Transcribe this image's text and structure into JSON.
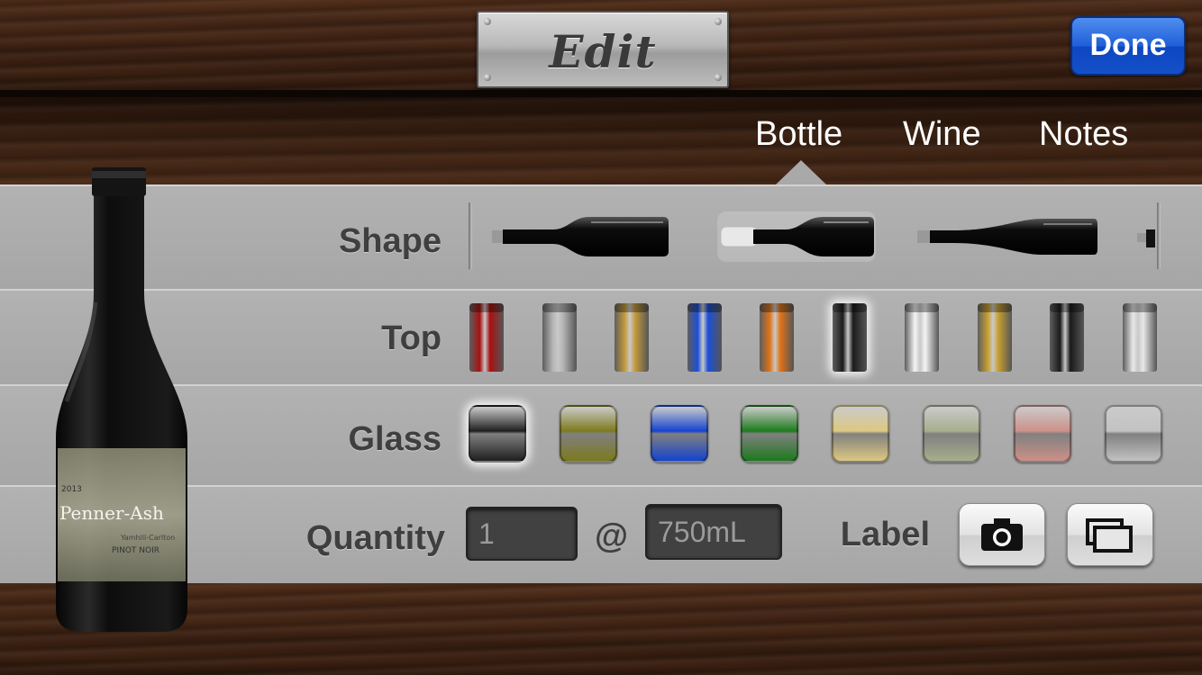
{
  "header": {
    "title": "Edit",
    "done_label": "Done"
  },
  "tabs": [
    {
      "label": "Bottle",
      "selected": true
    },
    {
      "label": "Wine",
      "selected": false
    },
    {
      "label": "Notes",
      "selected": false
    }
  ],
  "rows": {
    "shape": {
      "label": "Shape",
      "options": [
        "bottle-shape-burgundy",
        "bottle-shape-champagne",
        "bottle-shape-riesling"
      ],
      "selected_index": 1
    },
    "top": {
      "label": "Top",
      "options": [
        "#a81010",
        "#b5b5b5",
        "#c49a3a",
        "#1c4fd8",
        "#e07418",
        "#1b1b1b",
        "#f4f4f4",
        "#c8a030",
        "#1a1a1a",
        "#e8e8e8"
      ],
      "selected_index": 5
    },
    "glass": {
      "label": "Glass",
      "options": [
        "#1f1f1f",
        "#7c7a1c",
        "#1443d0",
        "#1c7a1c",
        "#ddc880",
        "#a6ae8c",
        "#cc9088",
        "#c2c2c2"
      ],
      "selected_index": 0
    },
    "quantity": {
      "label": "Quantity",
      "value": "1",
      "at_symbol": "@",
      "size": "750mL",
      "label_text": "Label",
      "camera_icon": "camera-icon",
      "gallery_icon": "photo-library-icon"
    }
  },
  "preview_bottle": {
    "label_vintage": "2013",
    "label_brand": "Penner-Ash",
    "label_region": "Yamhill-Carlton",
    "label_varietal": "PINOT NOIR"
  }
}
